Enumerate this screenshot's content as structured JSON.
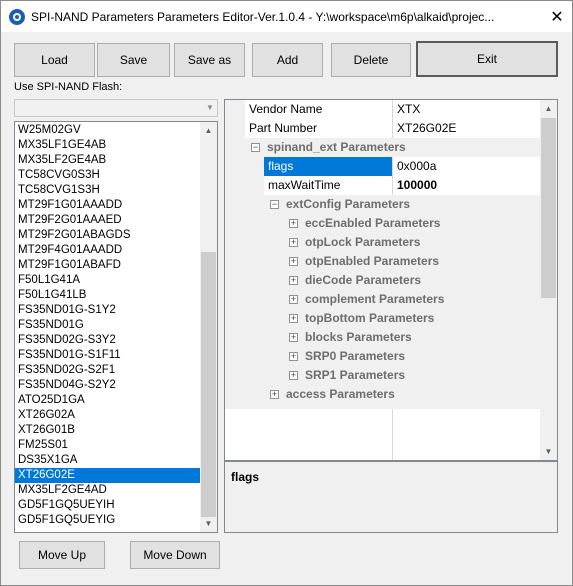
{
  "window": {
    "title": "SPI-NAND Parameters Parameters Editor-Ver.1.0.4 - Y:\\workspace\\m6p\\alkaid\\projec...",
    "close_glyph": "✕"
  },
  "toolbar": {
    "load_label": "Load",
    "save_label": "Save",
    "save_as_label": "Save as",
    "add_label": "Add",
    "delete_label": "Delete",
    "exit_label": "Exit"
  },
  "flash_list": {
    "label": "Use SPI-NAND Flash:",
    "selected_value": "",
    "items": [
      "W25M02GV",
      "MX35LF1GE4AB",
      "MX35LF2GE4AB",
      "TC58CVG0S3H",
      "TC58CVG1S3H",
      "MT29F1G01AAADD",
      "MT29F2G01AAAED",
      "MT29F2G01ABAGDS",
      "MT29F4G01AAADD",
      "MT29F1G01ABAFD",
      "F50L1G41A",
      "F50L1G41LB",
      "FS35ND01G-S1Y2",
      "FS35ND01G",
      "FS35ND02G-S3Y2",
      "FS35ND01G-S1F11",
      "FS35ND02G-S2F1",
      "FS35ND04G-S2Y2",
      "ATO25D1GA",
      "XT26G02A",
      "XT26G01B",
      "FM25S01",
      "DS35X1GA",
      "XT26G02E",
      "MX35LF2GE4AD",
      "GD5F1GQ5UEYIH",
      "GD5F1GQ5UEYIG"
    ],
    "selected_index": 23
  },
  "bottom": {
    "move_up_label": "Move Up",
    "move_down_label": "Move Down"
  },
  "properties": {
    "rows": [
      {
        "kind": "prop",
        "name": "Vendor Name",
        "value": "XTX",
        "indent": 0
      },
      {
        "kind": "prop",
        "name": "Part Number",
        "value": "XT26G02E",
        "indent": 0
      },
      {
        "kind": "cat",
        "name": "spinand_ext Parameters",
        "expanded": true,
        "indent": 0
      },
      {
        "kind": "prop",
        "name": "flags",
        "value": "0x000a",
        "indent": 1,
        "selected": true
      },
      {
        "kind": "prop",
        "name": "maxWaitTime",
        "value": "100000",
        "indent": 1,
        "bold_value": true
      },
      {
        "kind": "cat",
        "name": "extConfig Parameters",
        "expanded": true,
        "indent": 1
      },
      {
        "kind": "cat",
        "name": "eccEnabled Parameters",
        "expanded": false,
        "indent": 2
      },
      {
        "kind": "cat",
        "name": "otpLock Parameters",
        "expanded": false,
        "indent": 2
      },
      {
        "kind": "cat",
        "name": "otpEnabled Parameters",
        "expanded": false,
        "indent": 2
      },
      {
        "kind": "cat",
        "name": "dieCode Parameters",
        "expanded": false,
        "indent": 2
      },
      {
        "kind": "cat",
        "name": "complement Parameters",
        "expanded": false,
        "indent": 2
      },
      {
        "kind": "cat",
        "name": "topBottom Parameters",
        "expanded": false,
        "indent": 2
      },
      {
        "kind": "cat",
        "name": "blocks Parameters",
        "expanded": false,
        "indent": 2
      },
      {
        "kind": "cat",
        "name": "SRP0 Parameters",
        "expanded": false,
        "indent": 2
      },
      {
        "kind": "cat",
        "name": "SRP1 Parameters",
        "expanded": false,
        "indent": 2
      },
      {
        "kind": "cat",
        "name": "access Parameters",
        "expanded": false,
        "indent": 1
      }
    ]
  },
  "description": {
    "title": "flags"
  },
  "colors": {
    "selection": "#0078d7",
    "category_text": "#6d6d6d",
    "button_face": "#e1e1e1"
  }
}
